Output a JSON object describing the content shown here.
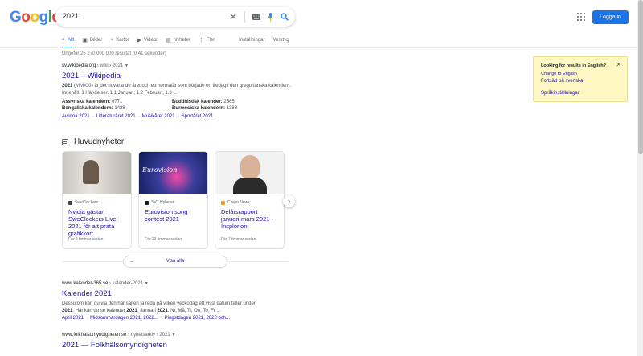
{
  "header": {
    "logo": "Google",
    "search_value": "2021",
    "login": "Logga in"
  },
  "colors": {
    "accent": "#1a73e8",
    "link": "#1a0dab",
    "logo_letters": [
      "#4285f4",
      "#ea4335",
      "#fbbc05",
      "#4285f4",
      "#34a853",
      "#ea4335"
    ]
  },
  "tabs": [
    {
      "label": "Allt",
      "icon": "search-icon"
    },
    {
      "label": "Bilder",
      "icon": "image-icon"
    },
    {
      "label": "Kartor",
      "icon": "map-pin-icon"
    },
    {
      "label": "Videor",
      "icon": "video-icon"
    },
    {
      "label": "Nyheter",
      "icon": "news-icon"
    },
    {
      "label": "Fler",
      "icon": "more-icon"
    },
    {
      "label": "Inställningar",
      "icon": ""
    },
    {
      "label": "Verktyg",
      "icon": ""
    }
  ],
  "result_stats": "Ungefär 25 270 000 000 resultat (0,41 sekunder)",
  "results": [
    {
      "site": "sv.wikipedia.org",
      "path": "› wiki › 2021",
      "title": "2021 – Wikipedia",
      "snippet_bold": "2021",
      "snippet_rest": " (MMXXI) är det nuvarande året och ett normalår som började en fredag i den gregorianska kalendern. Innehåll. 1 Händelser. 1.1 Januari; 1.2 Februari; 1.3 ...",
      "facts": [
        {
          "label": "Assyriska kalendern:",
          "value": "6771"
        },
        {
          "label": "Buddhistisk kalender:",
          "value": "2565"
        },
        {
          "label": "Bengaliska kalendern:",
          "value": "1428"
        },
        {
          "label": "Burmesiska kalendern:",
          "value": "1383"
        }
      ],
      "links": [
        "Avlidna 2021",
        "Litteraturåret 2021",
        "Musikåret 2021",
        "Sportåret 2021"
      ]
    },
    {
      "site": "www.kalender-365.se",
      "path": "› kalender-2021",
      "title": "Kalender 2021",
      "snippet_1": "Dessutom kan du via den här sajten ta reda på vilken veckodag ett visst datum faller under",
      "snippet_2a": "2021",
      "snippet_2b": ". Här kan du se kalender ",
      "snippet_2c": "2021",
      "snippet_2d": ". Januari ",
      "snippet_2e": "2021",
      "snippet_2f": ". Nr, Må, Ti, On, To, Fr ...",
      "links": [
        "April 2021",
        "Midsommardagen 2021, 2022...",
        "Pingstdagen 2021, 2022 och..."
      ]
    },
    {
      "site": "www.folkhalsomyndigheten.se",
      "path": "› nyhetsarkiv › 2021",
      "title": "2021 — Folkhälsomyndigheten"
    }
  ],
  "news": {
    "heading": "Huvudnyheter",
    "see_all": "Visa alla",
    "cards": [
      {
        "source": "SweClockers",
        "title": "Nvidia gästar SweClockers Live! 2021 för att prata grafikkort",
        "time": "För 2 timmar sedan"
      },
      {
        "source": "SVT Nyheter",
        "title": "Eurovision song contest 2021",
        "time": "För 23 timmar sedan"
      },
      {
        "source": "Cision News",
        "title": "Delårsrapport januari-mars 2021 - Insplorion",
        "time": "För 7 timmar sedan"
      }
    ]
  },
  "language_box": {
    "question": "Looking for results in English?",
    "change": "Change to English",
    "continue": "Fortsätt på svenska",
    "settings": "Språkinställningar"
  }
}
